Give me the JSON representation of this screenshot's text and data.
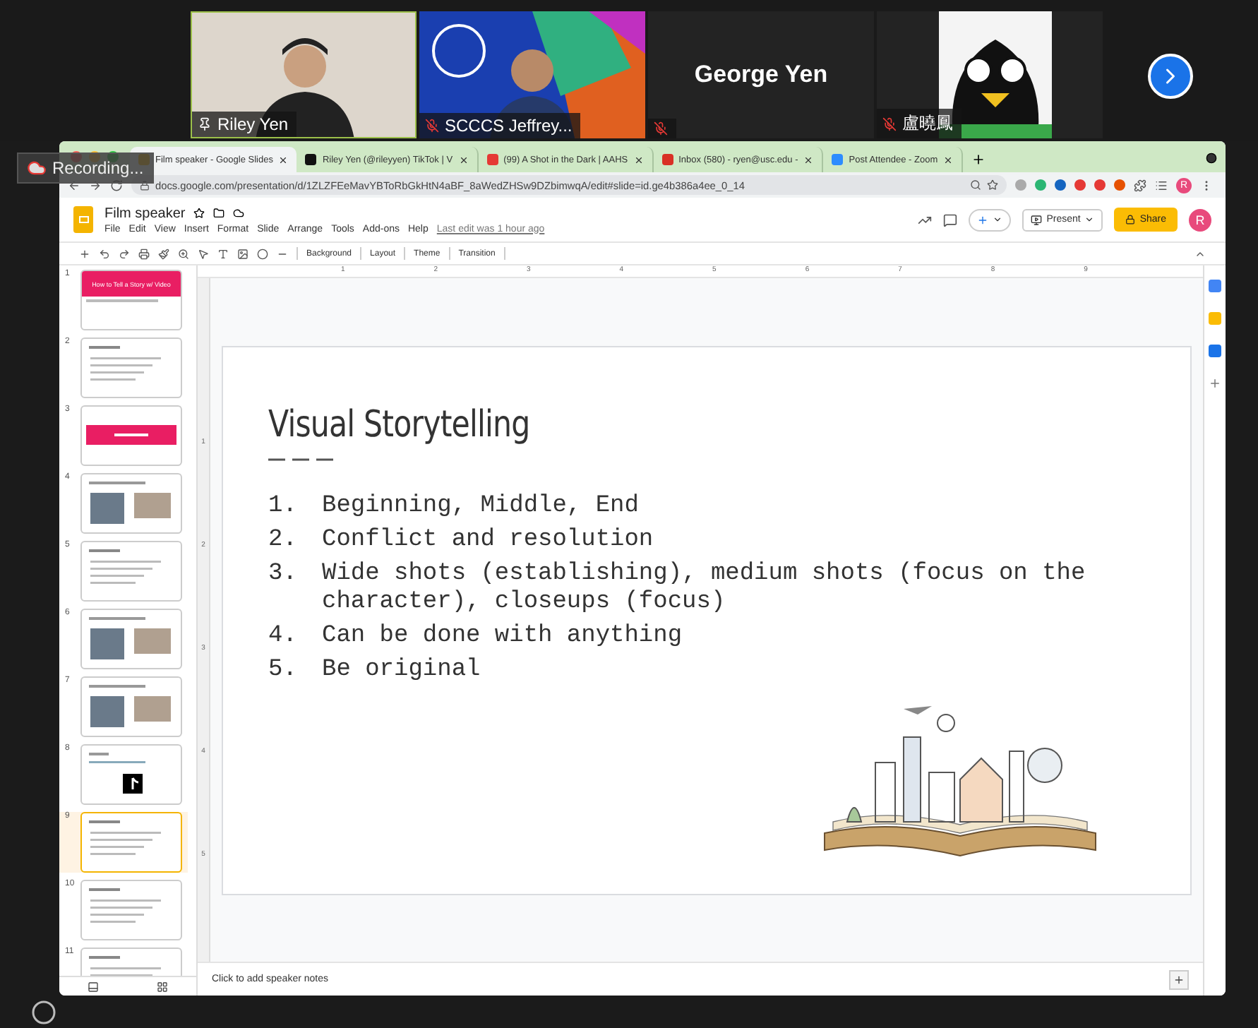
{
  "meeting": {
    "recording": "Recording...",
    "participants": [
      {
        "name": "Riley Yen",
        "kind": "video",
        "muted": false
      },
      {
        "name": "SCCCS Jeffrey...",
        "kind": "video",
        "muted": true
      },
      {
        "name": "George Yen",
        "kind": "name_only",
        "muted": true
      },
      {
        "name": "盧曉鳳",
        "kind": "video",
        "muted": true
      }
    ]
  },
  "browser": {
    "tabs": [
      {
        "title": "Film speaker - Google Slides",
        "kind": "slides",
        "selected": true
      },
      {
        "title": "Riley Yen (@rileyyen) TikTok | V",
        "kind": "tiktok",
        "selected": false
      },
      {
        "title": "(99) A Shot in the Dark | AAHS",
        "kind": "youtube",
        "selected": false
      },
      {
        "title": "Inbox (580) - ryen@usc.edu -",
        "kind": "mail",
        "selected": false
      },
      {
        "title": "Post Attendee - Zoom",
        "kind": "zoom",
        "selected": false
      }
    ],
    "address": "docs.google.com/presentation/d/1ZLZFEeMavYBToRbGkHtN4aBF_8aWedZHSw9DZbimwqA/edit#slide=id.ge4b386a4ee_0_14",
    "profile": "R"
  },
  "docs": {
    "title": "Film speaker",
    "menu": [
      "File",
      "Edit",
      "View",
      "Insert",
      "Format",
      "Slide",
      "Arrange",
      "Tools",
      "Add-ons",
      "Help"
    ],
    "last_edit": "Last edit was 1 hour ago",
    "present": "Present",
    "share": "Share",
    "avatar": "R",
    "toolbar": [
      "Background",
      "Layout",
      "Theme",
      "Transition"
    ],
    "ruler": [
      "1",
      "2",
      "3",
      "4",
      "5",
      "6",
      "7",
      "8",
      "9"
    ],
    "vertical_ruler": [
      "1",
      "2",
      "3",
      "4",
      "5"
    ]
  },
  "thumbnails": [
    {
      "number": "1",
      "kind": "title",
      "title": "How to Tell a Story w/ Video",
      "selected": false
    },
    {
      "number": "2",
      "kind": "text",
      "selected": false
    },
    {
      "number": "3",
      "kind": "banner",
      "selected": false
    },
    {
      "number": "4",
      "kind": "photos",
      "selected": false
    },
    {
      "number": "5",
      "kind": "text",
      "selected": false
    },
    {
      "number": "6",
      "kind": "photos",
      "selected": false
    },
    {
      "number": "7",
      "kind": "photos",
      "selected": false
    },
    {
      "number": "8",
      "kind": "logo",
      "selected": false
    },
    {
      "number": "9",
      "kind": "text",
      "selected": true
    },
    {
      "number": "10",
      "kind": "text",
      "selected": false
    },
    {
      "number": "11",
      "kind": "text",
      "selected": false
    }
  ],
  "slide": {
    "title": "Visual Storytelling",
    "items": [
      {
        "number": "1.",
        "text": "Beginning, Middle, End"
      },
      {
        "number": "2.",
        "text": "Conflict and resolution"
      },
      {
        "number": "3.",
        "text": "Wide shots (establishing), medium shots (focus on the character), closeups (focus)"
      },
      {
        "number": "4.",
        "text": "Can be done with anything"
      },
      {
        "number": "5.",
        "text": "Be original"
      }
    ]
  },
  "notes": {
    "placeholder": "Click to add speaker notes"
  }
}
